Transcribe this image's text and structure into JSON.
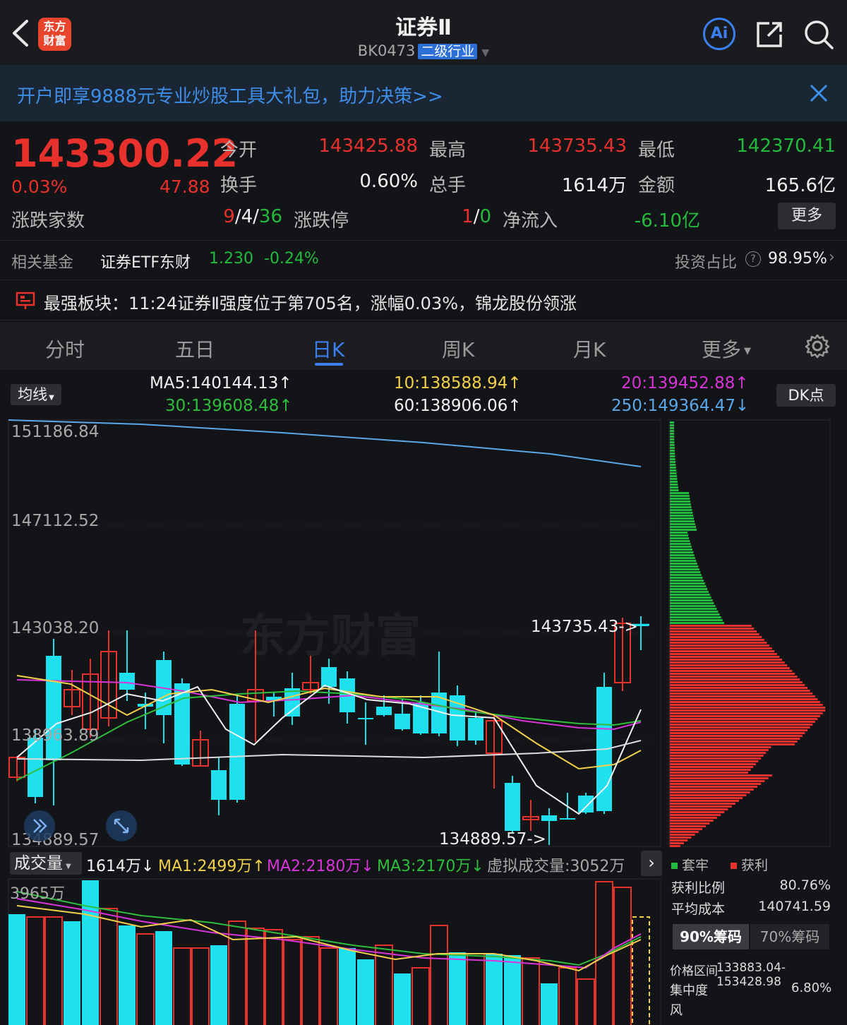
{
  "header": {
    "title": "证券Ⅱ",
    "code": "BK0473",
    "sector_tag": "二级行业",
    "logo_line1": "东方",
    "logo_line2": "财富",
    "ai_label": "Ai"
  },
  "banner": {
    "text": "开户即享9888元专业炒股工具大礼包，助力决策>>"
  },
  "quote": {
    "price": "143300.22",
    "change_pct": "0.03%",
    "change_abs": "47.88",
    "open_label": "今开",
    "open": "143425.88",
    "high_label": "最高",
    "high": "143735.43",
    "low_label": "最低",
    "low": "142370.41",
    "turnover_label": "换手",
    "turnover": "0.60%",
    "volume_label": "总手",
    "volume": "1614万",
    "amount_label": "金额",
    "amount": "165.6亿",
    "breadth_label": "涨跌家数",
    "breadth_up": "9",
    "breadth_sep1": "/",
    "breadth_flat": "4",
    "breadth_sep2": "/",
    "breadth_down": "36",
    "limit_label": "涨跌停",
    "limit_up": "1",
    "limit_sep": "/",
    "limit_down": "0",
    "netflow_label": "净流入",
    "netflow": "-6.10亿",
    "more_label": "更多"
  },
  "fund": {
    "label": "相关基金",
    "name": "证券ETF东财",
    "price": "1.230",
    "change": "-0.24%",
    "ratio_label": "投资占比",
    "ratio": "98.95%"
  },
  "notice": {
    "text": "最强板块：11:24证券Ⅱ强度位于第705名，涨幅0.03%，锦龙股份领涨"
  },
  "tabs": [
    "分时",
    "五日",
    "日K",
    "周K",
    "月K",
    "更多"
  ],
  "active_tab": "日K",
  "indicators": {
    "button": "均线",
    "ma5": "MA5:140144.13↑",
    "ma10": "10:138588.94↑",
    "ma20": "20:139452.88↑",
    "ma30": "30:139608.48↑",
    "ma60": "60:138906.06↑",
    "ma250": "250:149364.47↓",
    "dk_button": "DK点"
  },
  "kchart": {
    "y_labels": [
      "151186.84",
      "147112.52",
      "143038.20",
      "138963.89",
      "134889.57"
    ],
    "high_marker": "143735.43->",
    "low_marker": "134889.57->",
    "watermark": "东方财富",
    "colors": {
      "up": "#e8312c",
      "down": "#1ee0ef",
      "ma5": "#f2f2f2",
      "ma10": "#f2d04a",
      "ma20": "#d834d8",
      "ma30": "#2fbe3c",
      "ma60": "#ffffff",
      "ma250": "#5aa8e8"
    }
  },
  "volume": {
    "label": "成交量",
    "value": "1614万↓",
    "ma1": "MA1:2499万↑",
    "ma2": "MA2:2180万↓",
    "ma3": "MA3:2170万↓",
    "virtual": "虚拟成交量:3052万",
    "y_max_label": "3965万"
  },
  "chips": {
    "legend_trapped": "套牢",
    "legend_profit": "获利",
    "profit_ratio_label": "获利比例",
    "profit_ratio": "80.76%",
    "avg_cost_label": "平均成本",
    "avg_cost": "140741.59",
    "tab_90": "90%筹码",
    "tab_70": "70%筹码",
    "range_label": "价格区间",
    "range": "133883.04-153428.98",
    "concentration_label": "集中度",
    "concentration": "6.80%",
    "risk_label": "风"
  }
}
